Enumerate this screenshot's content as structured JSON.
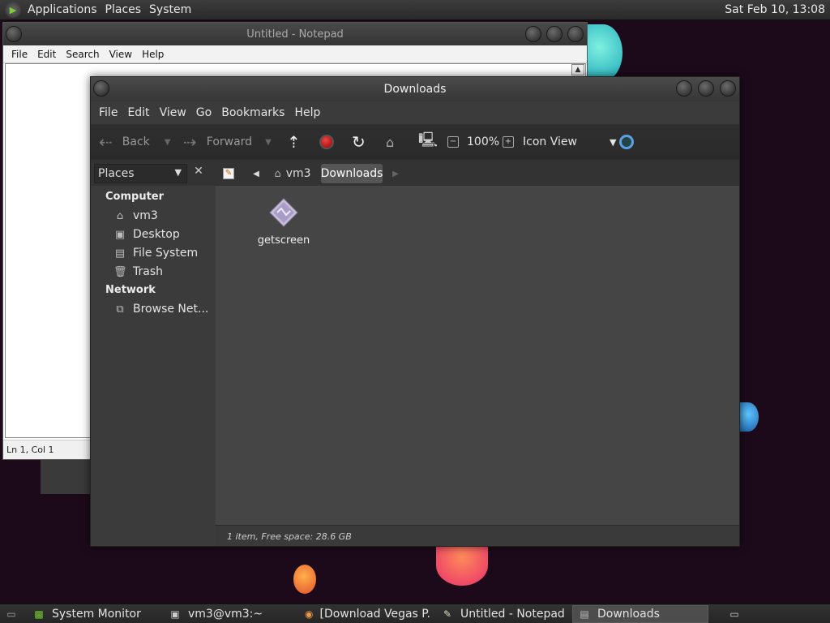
{
  "top_panel": {
    "menus": [
      "Applications",
      "Places",
      "System"
    ],
    "clock": "Sat Feb 10, 13:08"
  },
  "notepad": {
    "title": "Untitled - Notepad",
    "menus": [
      "File",
      "Edit",
      "Search",
      "View",
      "Help"
    ],
    "status": "Ln 1, Col 1"
  },
  "file_manager": {
    "title": "Downloads",
    "menus": [
      "File",
      "Edit",
      "View",
      "Go",
      "Bookmarks",
      "Help"
    ],
    "toolbar": {
      "back": "Back",
      "forward": "Forward",
      "zoom": "100%",
      "view_mode": "Icon View"
    },
    "sidebar_selector": "Places",
    "path": [
      "vm3",
      "Downloads"
    ],
    "sidebar": {
      "computer_header": "Computer",
      "computer_items": [
        "vm3",
        "Desktop",
        "File System",
        "Trash"
      ],
      "network_header": "Network",
      "network_items": [
        "Browse Net..."
      ]
    },
    "files": [
      {
        "name": "getscreen"
      }
    ],
    "status": "1 item, Free space: 28.6 GB"
  },
  "taskbar": {
    "items": [
      {
        "label": "System Monitor",
        "icon": "system-monitor-icon"
      },
      {
        "label": "vm3@vm3:~",
        "icon": "terminal-icon"
      },
      {
        "label": "[Download Vegas P...",
        "icon": "chrome-icon"
      },
      {
        "label": "Untitled - Notepad",
        "icon": "notepad-icon"
      },
      {
        "label": "Downloads",
        "icon": "folder-icon"
      }
    ]
  }
}
